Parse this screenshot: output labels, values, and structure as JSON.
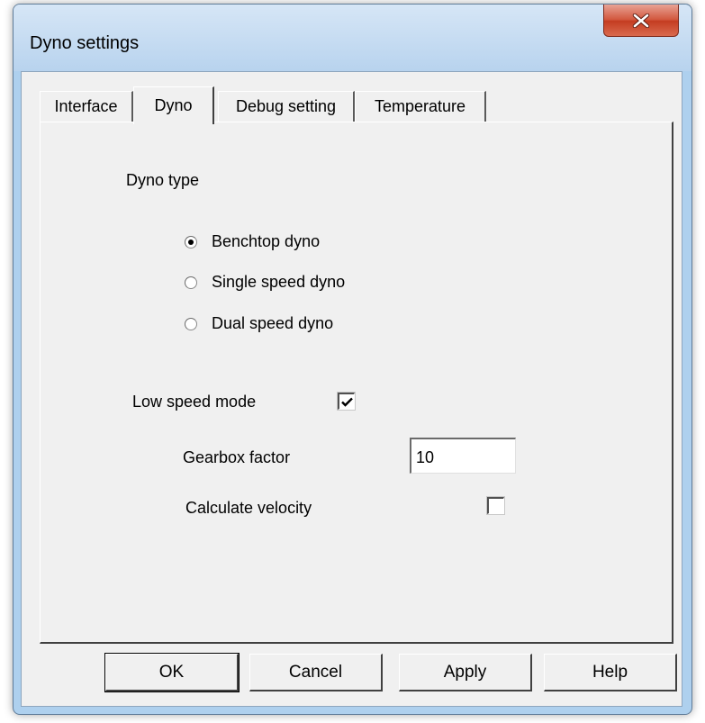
{
  "window": {
    "title": "Dyno settings"
  },
  "tabs": [
    {
      "label": "Interface",
      "active": false
    },
    {
      "label": "Dyno",
      "active": true
    },
    {
      "label": "Debug setting",
      "active": false
    },
    {
      "label": "Temperature",
      "active": false
    }
  ],
  "dyno": {
    "dyno_type_label": "Dyno type",
    "radios": [
      {
        "label": "Benchtop dyno",
        "selected": true
      },
      {
        "label": "Single speed dyno",
        "selected": false
      },
      {
        "label": "Dual speed dyno",
        "selected": false
      }
    ],
    "low_speed_mode": {
      "label": "Low speed mode",
      "checked": true
    },
    "gearbox_factor": {
      "label": "Gearbox factor",
      "value": "10"
    },
    "calculate_velocity": {
      "label": "Calculate velocity",
      "checked": false
    }
  },
  "buttons": {
    "ok": "OK",
    "cancel": "Cancel",
    "apply": "Apply",
    "help": "Help"
  }
}
